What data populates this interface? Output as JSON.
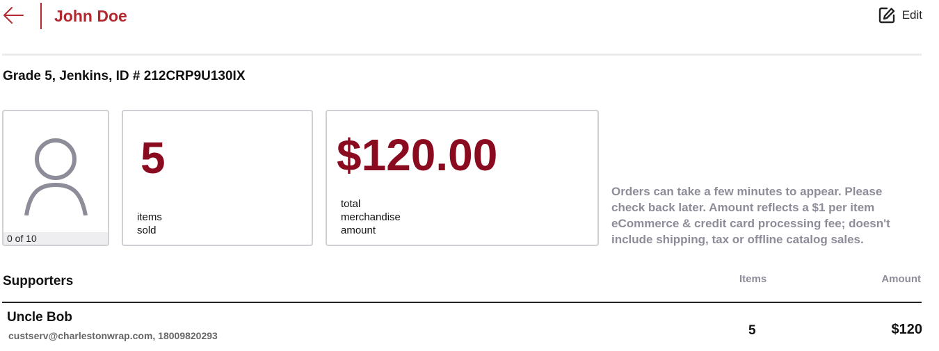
{
  "header": {
    "title": "John Doe",
    "edit_label": "Edit",
    "accent_color": "#b1282e"
  },
  "subtitle": "Grade 5, Jenkins, ID # 212CRP9U130IX",
  "stats": {
    "goal_progress": "0 of 10",
    "items_sold_value": "5",
    "items_sold_label": "items\nsold",
    "amount_value": "$120.00",
    "amount_label": "total\nmerchandise\namount",
    "value_color": "#8a0a1f"
  },
  "notice": "Orders can take a few minutes to appear. Please check back later. Amount reflects a $1 per item eCommerce & credit card processing fee; doesn't include shipping, tax or offline catalog sales.",
  "supporters": {
    "heading": "Supporters",
    "columns": {
      "items": "Items",
      "amount": "Amount"
    },
    "rows": [
      {
        "name": "Uncle Bob",
        "contact": "custserv@charlestonwrap.com, 18009820293",
        "items": "5",
        "amount": "$120"
      }
    ]
  },
  "icons": {
    "back": "arrow-left-icon",
    "edit": "edit-icon",
    "avatar": "user-avatar-icon"
  }
}
